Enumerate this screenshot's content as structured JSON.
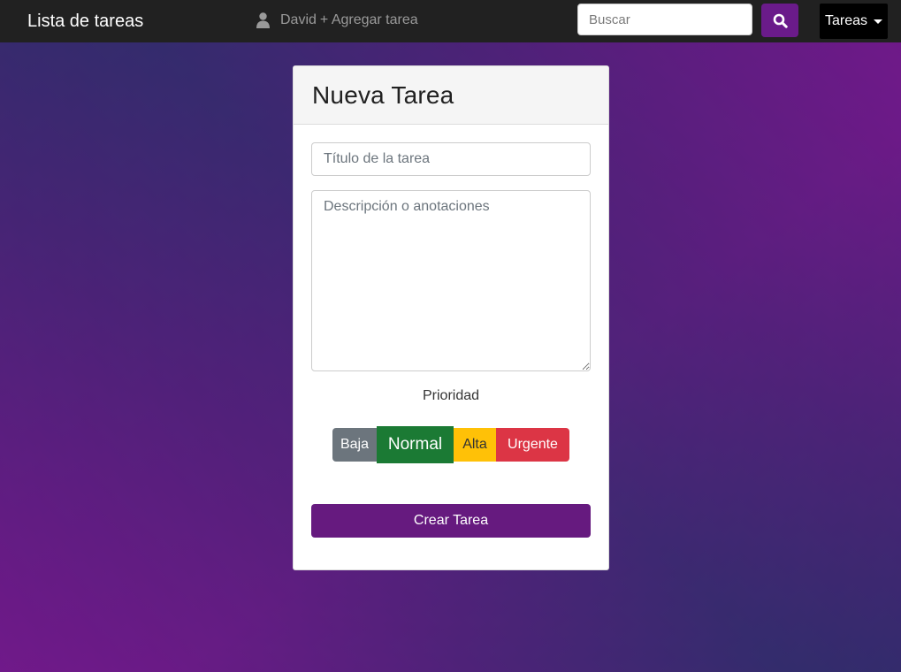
{
  "navbar": {
    "brand": "Lista de tareas",
    "user_name": "David",
    "add_task_link": "+ Agregar tarea",
    "search_placeholder": "Buscar",
    "dropdown_label": "Tareas",
    "icons": {
      "user": "user-icon",
      "search": "search-icon",
      "dropdown": "caret-down-icon"
    }
  },
  "card": {
    "title": "Nueva Tarea",
    "title_placeholder": "Título de la tarea",
    "description_placeholder": "Descripción o anotaciones",
    "priority_label": "Prioridad",
    "priorities": [
      {
        "label": "Baja",
        "color": "#6c757d"
      },
      {
        "label": "Normal",
        "color": "#1b7a34",
        "selected": true
      },
      {
        "label": "Alta",
        "color": "#ffc107"
      },
      {
        "label": "Urgente",
        "color": "#dc3545"
      }
    ],
    "submit_label": "Crear Tarea"
  },
  "colors": {
    "navbar_bg": "#212121",
    "accent": "#661a7f",
    "background_gradient": [
      "#2e2f6b",
      "#7a1a8e"
    ]
  }
}
